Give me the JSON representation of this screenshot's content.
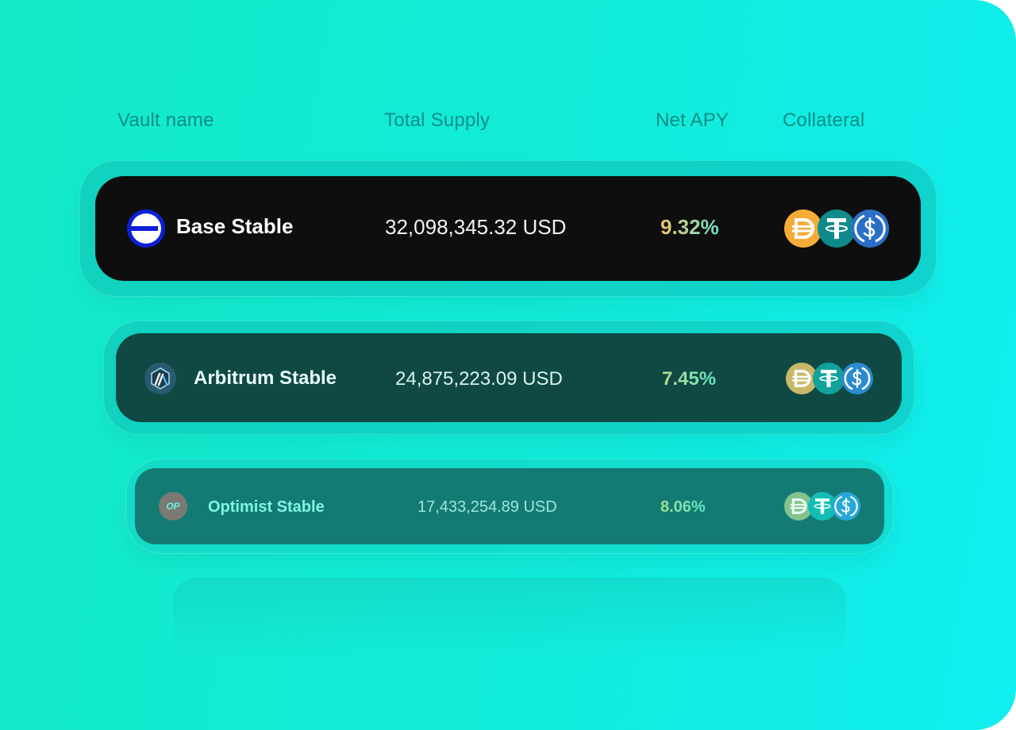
{
  "columns": {
    "vault_name": "Vault name",
    "total_supply": "Total Supply",
    "net_apy": "Net APY",
    "collateral": "Collateral"
  },
  "vaults": [
    {
      "name": "Base Stable",
      "chain_icon": "base-chain-icon",
      "total_supply": "32,098,345.32 USD",
      "net_apy": "9.32%",
      "collateral": [
        "dai-icon",
        "usdt-icon",
        "usdc-icon"
      ]
    },
    {
      "name": "Arbitrum Stable",
      "chain_icon": "arbitrum-chain-icon",
      "total_supply": "24,875,223.09 USD",
      "net_apy": "7.45%",
      "collateral": [
        "dai-icon",
        "usdt-icon",
        "usdc-icon"
      ]
    },
    {
      "name": "Optimist Stable",
      "chain_icon": "optimism-chain-icon",
      "chain_icon_label": "OP",
      "total_supply": "17,433,254.89 USD",
      "net_apy": "8.06%",
      "collateral": [
        "dai-icon",
        "usdt-icon",
        "usdc-icon"
      ]
    }
  ],
  "colors": {
    "background_start": "#14eac8",
    "background_end": "#10eef0",
    "header_text": "#0b8d86",
    "row1_bg": "#0e0e0e",
    "row2_bg": "#104944",
    "row3_bg": "#147b74",
    "dai": "#f5ac37",
    "usdt": "#26a17b",
    "usdc": "#2775ca"
  }
}
